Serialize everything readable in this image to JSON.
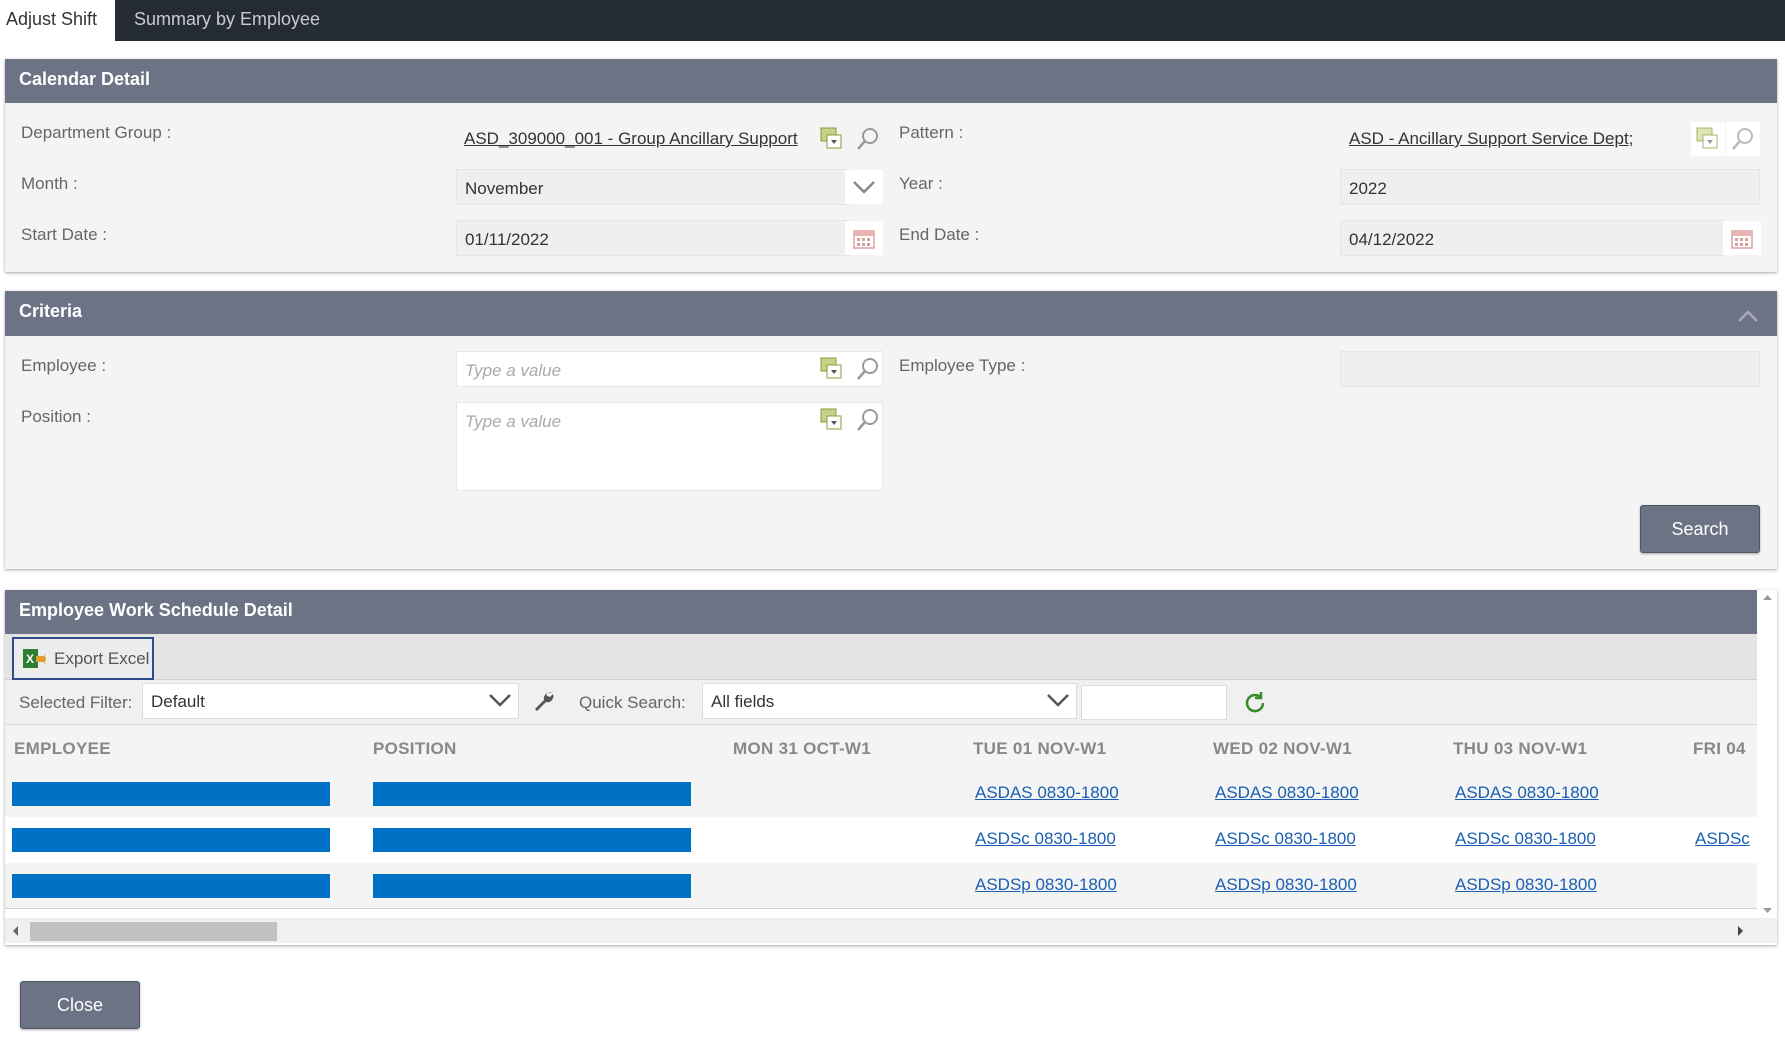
{
  "tabs": [
    {
      "label": "Adjust Shift",
      "active": true
    },
    {
      "label": "Summary by Employee",
      "active": false
    }
  ],
  "calendar": {
    "title": "Calendar Detail",
    "department_group": {
      "label": "Department Group :",
      "value": "ASD_309000_001 - Group Ancillary Support"
    },
    "pattern": {
      "label": "Pattern :",
      "value": "ASD - Ancillary Support Service Dept;"
    },
    "month": {
      "label": "Month :",
      "value": "November"
    },
    "year": {
      "label": "Year :",
      "value": "2022"
    },
    "start_date": {
      "label": "Start Date :",
      "value": "01/11/2022"
    },
    "end_date": {
      "label": "End Date :",
      "value": "04/12/2022"
    }
  },
  "criteria": {
    "title": "Criteria",
    "employee": {
      "label": "Employee :",
      "placeholder": "Type a value"
    },
    "employee_type": {
      "label": "Employee Type :",
      "value": ""
    },
    "position": {
      "label": "Position :",
      "placeholder": "Type a value"
    },
    "search_label": "Search"
  },
  "schedule": {
    "title": "Employee Work Schedule Detail",
    "export_label": "Export Excel",
    "selected_filter_label": "Selected Filter:",
    "selected_filter_value": "Default",
    "quick_search_label": "Quick Search:",
    "quick_search_value": "All fields",
    "quick_search_text": "",
    "columns": [
      "EMPLOYEE",
      "POSITION",
      "MON 31 OCT-W1",
      "TUE 01 NOV-W1",
      "WED 02 NOV-W1",
      "THU 03 NOV-W1",
      "FRI 04"
    ],
    "rows": [
      {
        "employee": "",
        "position": "",
        "mon": "",
        "tue": "ASDAS 0830-1800",
        "wed": "ASDAS 0830-1800",
        "thu": "ASDAS 0830-1800",
        "fri": ""
      },
      {
        "employee": "",
        "position": "",
        "mon": "",
        "tue": "ASDSc 0830-1800",
        "wed": "ASDSc 0830-1800",
        "thu": "ASDSc 0830-1800",
        "fri": "ASDSc"
      },
      {
        "employee": "",
        "position": "",
        "mon": "",
        "tue": "ASDSp 0830-1800",
        "wed": "ASDSp 0830-1800",
        "thu": "ASDSp 0830-1800",
        "fri": ""
      }
    ]
  },
  "close_label": "Close",
  "colors": {
    "header": "#6b7385",
    "topbar": "#252b33",
    "redacted": "#0072c6",
    "link": "#1a5fb4"
  }
}
